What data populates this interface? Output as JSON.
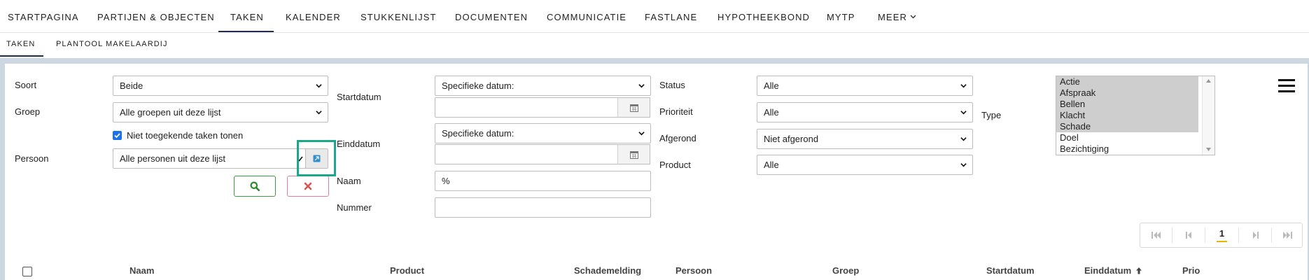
{
  "top_nav": {
    "items": [
      "STARTPAGINA",
      "PARTIJEN & OBJECTEN",
      "TAKEN",
      "KALENDER",
      "STUKKENLIJST",
      "DOCUMENTEN",
      "COMMUNICATIE",
      "FASTLANE",
      "HYPOTHEEKBOND",
      "MYTP",
      "MEER"
    ],
    "active": "TAKEN"
  },
  "sub_nav": {
    "items": [
      "TAKEN",
      "PLANTOOL MAKELAARDIJ"
    ],
    "active": "TAKEN"
  },
  "filters": {
    "soort": {
      "label": "Soort",
      "value": "Beide"
    },
    "groep": {
      "label": "Groep",
      "value": "Alle groepen uit deze lijst"
    },
    "niet_toegekend": {
      "label": "Niet toegekende taken tonen",
      "checked": true
    },
    "persoon": {
      "label": "Persoon",
      "value": "Alle personen uit deze lijst"
    },
    "startdatum": {
      "label": "Startdatum",
      "mode": "Specifieke datum:",
      "date": ""
    },
    "einddatum": {
      "label": "Einddatum",
      "mode": "Specifieke datum:",
      "date": ""
    },
    "naam": {
      "label": "Naam",
      "value": "%"
    },
    "nummer": {
      "label": "Nummer",
      "value": ""
    },
    "status": {
      "label": "Status",
      "value": "Alle"
    },
    "prioriteit": {
      "label": "Prioriteit",
      "value": "Alle"
    },
    "afgerond": {
      "label": "Afgerond",
      "value": "Niet afgerond"
    },
    "product": {
      "label": "Product",
      "value": "Alle"
    },
    "type": {
      "label": "Type",
      "options": [
        "Actie",
        "Afspraak",
        "Bellen",
        "Klacht",
        "Schade",
        "Doel",
        "Bezichtiging"
      ],
      "selected": [
        "Actie",
        "Afspraak",
        "Bellen",
        "Klacht",
        "Schade"
      ]
    }
  },
  "icons": {
    "search": "search-icon",
    "clear": "close-icon",
    "calendar": "calendar-icon",
    "external": "external-link-icon",
    "menu": "hamburger-menu-icon"
  },
  "colors": {
    "search_button_border": "#3f9a3f",
    "clear_button_border": "#e47aa0",
    "highlight": "#1aa78a",
    "checkbox": "#1a73e8",
    "pager_active_underline": "#e6b800"
  },
  "pager": {
    "current_page": "1"
  },
  "table": {
    "columns": [
      "Naam",
      "Product",
      "Schademelding",
      "Persoon",
      "Groep",
      "Startdatum",
      "Einddatum",
      "Prio"
    ],
    "sorted_column": "Einddatum",
    "sort_direction": "ascending"
  }
}
